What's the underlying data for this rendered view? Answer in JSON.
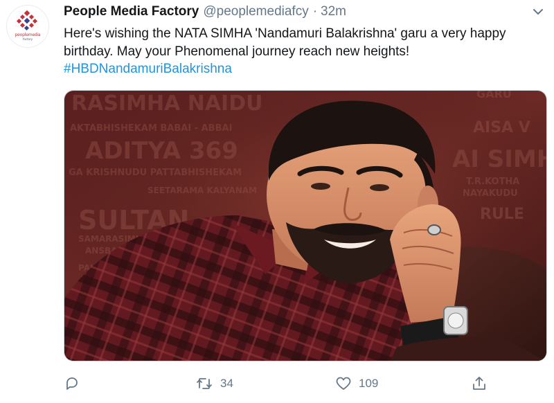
{
  "tweet": {
    "author": {
      "display_name": "People Media Factory",
      "handle": "@peoplemediafcy",
      "separator": "·",
      "time": "32m",
      "avatar_text": "peoplemedia",
      "avatar_subtext": "factory"
    },
    "text": "Here's wishing the NATA SIMHA 'Nandamuri Balakrishna' garu a very happy birthday. May your Phenomenal journey reach new heights!",
    "hashtag": "#HBDNandamuriBalakrishna",
    "media": {
      "titles": [
        "RASIMHA NAIDU",
        "AKTABHISHEKAM  BABAI - ABBAI",
        "ADITYA 369",
        "GA KRISHNUDU  PATTABHISHEKAM",
        "SEETARAMA KALYANAM",
        "SULTAN",
        "SAMARASIMHA",
        "ANSBAB",
        "PALNATI",
        "RA",
        "GARU",
        "AISA V",
        "AI SIMH",
        "T.R.KOTHA",
        "NAYAKUDU",
        "RULE"
      ]
    },
    "actions": {
      "reply_count": "",
      "retweet_count": "34",
      "like_count": "109"
    },
    "icons": {
      "caret": "chevron-down-icon",
      "reply": "reply-icon",
      "retweet": "retweet-icon",
      "like": "heart-icon",
      "share": "share-icon"
    },
    "colors": {
      "link": "#1b95e0",
      "secondary_text": "#657786",
      "primary_text": "#14171a",
      "brand_red": "#c6303a"
    }
  }
}
